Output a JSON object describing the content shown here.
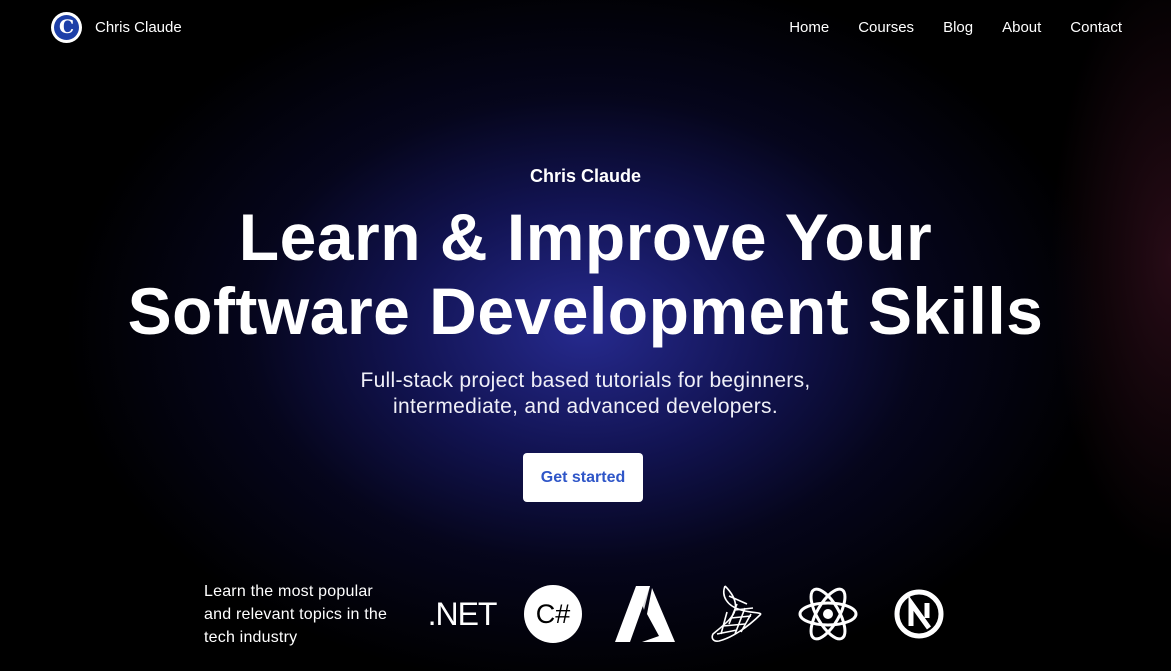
{
  "header": {
    "brand": "Chris Claude",
    "logo_letter": "C",
    "nav": [
      "Home",
      "Courses",
      "Blog",
      "About",
      "Contact"
    ]
  },
  "hero": {
    "eyebrow": "Chris Claude",
    "headline_line1": "Learn & Improve Your",
    "headline_line2": "Software Development Skills",
    "sub_line1": "Full-stack project based tutorials for beginners,",
    "sub_line2": "intermediate, and advanced developers.",
    "cta": "Get started"
  },
  "topics": {
    "text_line1": "Learn the most popular",
    "text_line2": "and relevant topics in the",
    "text_line3": "tech industry"
  },
  "tech_logos": {
    "net_label": ".NET",
    "csharp_label": "C#",
    "icons": [
      "dotnet-icon",
      "csharp-icon",
      "azure-icon",
      "sql-server-icon",
      "react-icon",
      "nextjs-icon"
    ]
  },
  "colors": {
    "background": "#000000",
    "glow": "#282c96",
    "cta_text": "#2f56c8",
    "logo_blue": "#1d3fa8"
  }
}
